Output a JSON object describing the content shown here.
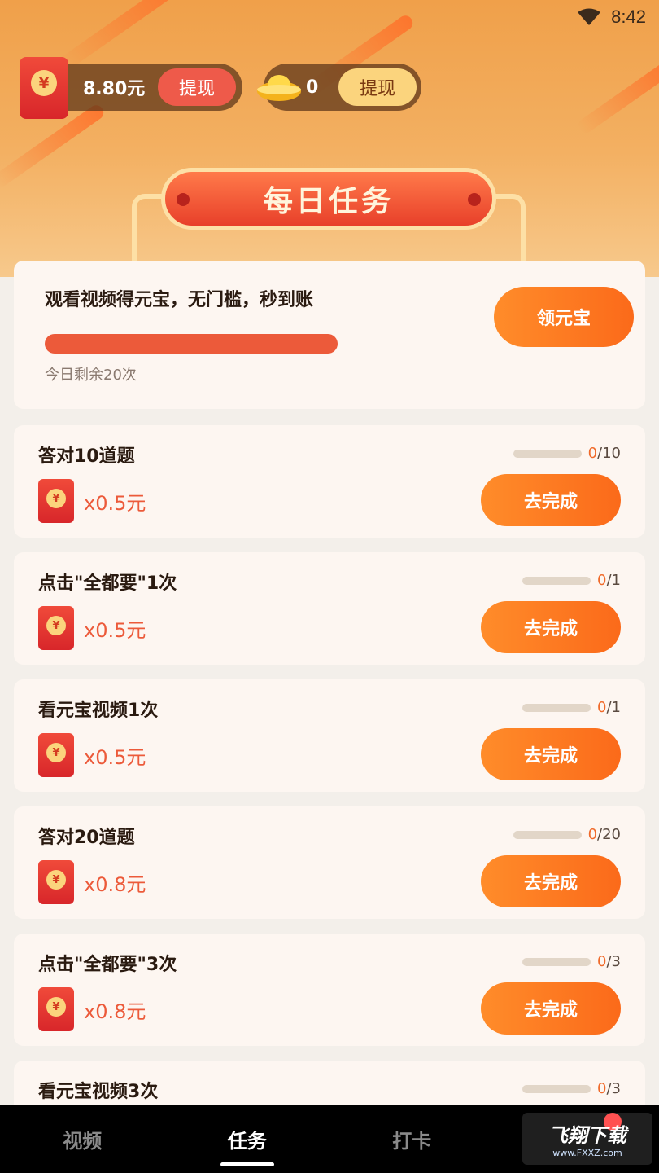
{
  "status_bar": {
    "time": "8:42"
  },
  "wallet": {
    "cash_value": "8.80元",
    "cash_withdraw_label": "提现",
    "ingot_value": "0",
    "ingot_withdraw_label": "提现",
    "currency_symbol": "¥"
  },
  "header": {
    "title": "每日任务"
  },
  "video_task": {
    "title": "观看视频得元宝，无门槛，秒到账",
    "remaining": "今日剩余20次",
    "claim_label": "领元宝",
    "progress_fraction": 1.0
  },
  "tasks": [
    {
      "name": "答对10道题",
      "done": "0",
      "total": "/10",
      "reward": "x0.5元",
      "button": "去完成"
    },
    {
      "name": "点击\"全都要\"1次",
      "done": "0",
      "total": "/1",
      "reward": "x0.5元",
      "button": "去完成"
    },
    {
      "name": "看元宝视频1次",
      "done": "0",
      "total": "/1",
      "reward": "x0.5元",
      "button": "去完成"
    },
    {
      "name": "答对20道题",
      "done": "0",
      "total": "/20",
      "reward": "x0.8元",
      "button": "去完成"
    },
    {
      "name": "点击\"全都要\"3次",
      "done": "0",
      "total": "/3",
      "reward": "x0.8元",
      "button": "去完成"
    },
    {
      "name": "看元宝视频3次",
      "done": "0",
      "total": "/3",
      "reward": "",
      "button": ""
    }
  ],
  "tabbar": {
    "tabs": [
      "视频",
      "任务",
      "打卡",
      ""
    ],
    "active_index": 1
  },
  "watermark": {
    "logo": "飞翔下载",
    "url": "www.FXXZ.com"
  },
  "colors": {
    "accent_orange": "#fb6a1a",
    "reward_red": "#ec5a3a",
    "hero": "#f0a04a"
  },
  "icons": [
    "wifi-icon",
    "red-envelope-icon",
    "gold-ingot-icon"
  ]
}
